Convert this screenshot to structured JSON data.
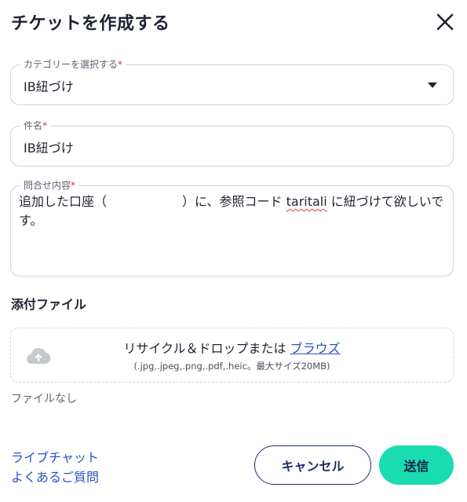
{
  "dialog": {
    "title": "チケットを作成する",
    "close_icon": "close-icon"
  },
  "form": {
    "category": {
      "label": "カテゴリーを選択する",
      "required_mark": "*",
      "value": "IB紐づけ"
    },
    "subject": {
      "label": "件名",
      "required_mark": "*",
      "value": "IB紐づけ"
    },
    "body": {
      "label": "問合せ内容",
      "required_mark": "*",
      "text_before": "追加した口座（",
      "text_after": "）に、参照コード ",
      "misspelled_word": "taritali",
      "text_end": " に紐づけて欲しいです。"
    }
  },
  "attachments": {
    "title": "添付ファイル",
    "drop_text": "リサイクル＆ドロップまたは",
    "browse_link": "ブラウズ",
    "hint": "(.jpg,.jpeg,.png,.pdf,.heic。最大サイズ20MB)",
    "upload_icon": "cloud-upload-icon",
    "status": "ファイルなし"
  },
  "footer": {
    "live_chat": "ライブチャット",
    "faq": "よくあるご質問",
    "cancel": "キャンセル",
    "send": "送信"
  },
  "colors": {
    "accent": "#19dcb0",
    "navy": "#1b2f6b",
    "link": "#2a52be",
    "required": "#e0304b"
  }
}
